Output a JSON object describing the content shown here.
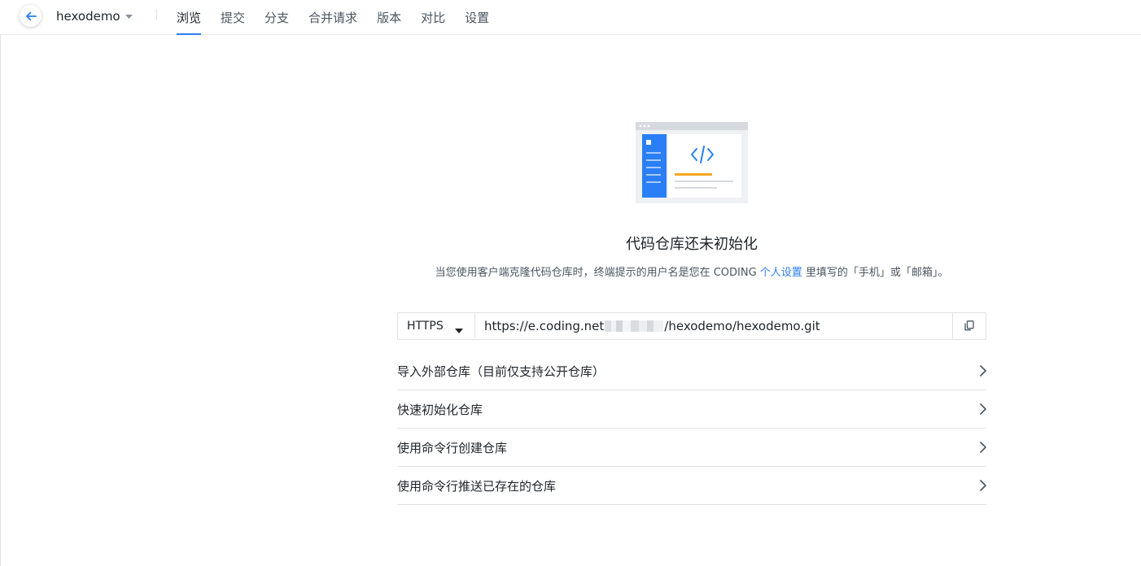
{
  "header": {
    "repo_name": "hexodemo",
    "tabs": [
      {
        "label": "浏览",
        "active": true
      },
      {
        "label": "提交",
        "active": false
      },
      {
        "label": "分支",
        "active": false
      },
      {
        "label": "合并请求",
        "active": false
      },
      {
        "label": "版本",
        "active": false
      },
      {
        "label": "对比",
        "active": false
      },
      {
        "label": "设置",
        "active": false
      }
    ]
  },
  "empty_state": {
    "title": "代码仓库还未初始化",
    "desc_before": "当您使用客户端克隆代码仓库时，终端提示的用户名是您在 CODING ",
    "desc_link": "个人设置",
    "desc_after": " 里填写的「手机」或「邮箱」。"
  },
  "clone": {
    "protocol": "HTTPS",
    "url_prefix": "https://e.coding.net",
    "url_suffix": "/hexodemo/hexodemo.git"
  },
  "options": [
    {
      "label": "导入外部仓库（目前仅支持公开仓库）"
    },
    {
      "label": "快速初始化仓库"
    },
    {
      "label": "使用命令行创建仓库"
    },
    {
      "label": "使用命令行推送已存在的仓库"
    }
  ],
  "colors": {
    "accent": "#2a7ff6",
    "illustration_orange": "#f5a623",
    "border": "#dfe2e5"
  }
}
